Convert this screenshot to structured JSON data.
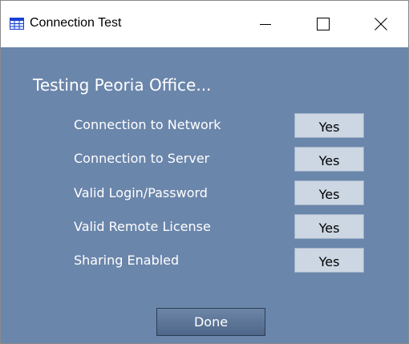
{
  "window": {
    "title": "Connection Test",
    "app_icon": "grid-table-icon",
    "controls": [
      "minimize-icon",
      "maximize-icon",
      "close-icon"
    ]
  },
  "heading": "Testing Peoria Office...",
  "checks": [
    {
      "label": "Connection to Network",
      "value": "Yes"
    },
    {
      "label": "Connection to Server",
      "value": "Yes"
    },
    {
      "label": "Valid Login/Password",
      "value": "Yes"
    },
    {
      "label": "Valid Remote License",
      "value": "Yes"
    },
    {
      "label": "Sharing Enabled",
      "value": "Yes"
    }
  ],
  "done_label": "Done",
  "colors": {
    "dialog_background": "#6b86ab",
    "value_box": "#ccd7e3",
    "button": "#4e6688"
  }
}
